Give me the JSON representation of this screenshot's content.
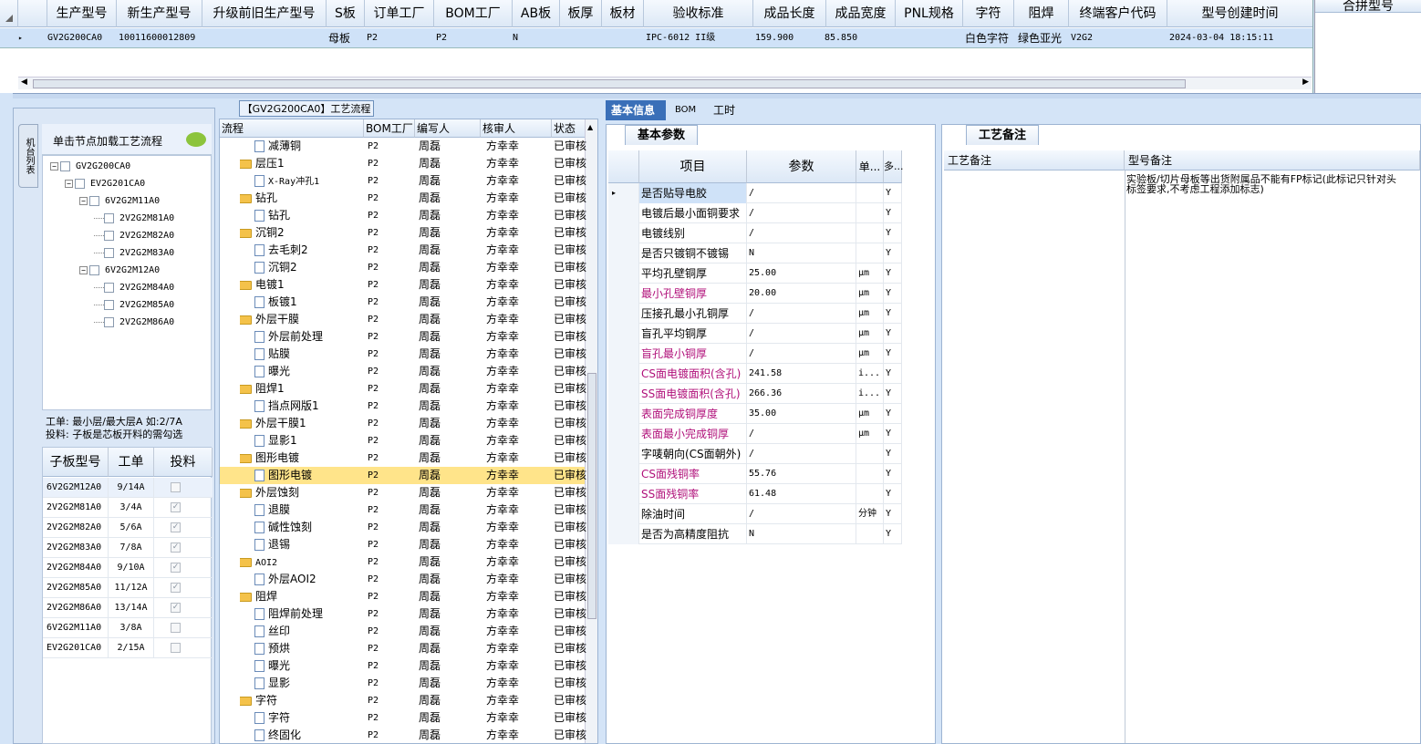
{
  "top_grid": {
    "headers": [
      "生产型号",
      "新生产型号",
      "升级前旧生产型号",
      "S板",
      "订单工厂",
      "BOM工厂",
      "AB板",
      "板厚",
      "板材",
      "验收标准",
      "成品长度",
      "成品宽度",
      "PNL规格",
      "字符",
      "阻焊",
      "终端客户代码",
      "型号创建时间"
    ],
    "row": {
      "marker": "▸",
      "model": "GV2G200CA0",
      "new_model": "10011600012809",
      "s_board": "母板",
      "order_factory": "P2",
      "bom_factory": "P2",
      "ab": "N",
      "standard": "IPC-6012 II级",
      "length": "159.900",
      "width": "85.850",
      "char": "白色字符",
      "solder": "绿色亚光",
      "customer": "V2G2",
      "created": "2024-03-04 18:15:11"
    },
    "merge_header": "合拼型号"
  },
  "left_panel": {
    "vtab": "机台列表",
    "hint": "单击节点加载工艺流程",
    "tree": [
      {
        "label": "GV2G200CA0",
        "level": 0,
        "exp": "−"
      },
      {
        "label": "EV2G201CA0",
        "level": 1,
        "exp": "−"
      },
      {
        "label": "6V2G2M11A0",
        "level": 2,
        "exp": "−"
      },
      {
        "label": "2V2G2M81A0",
        "level": 3,
        "exp": ""
      },
      {
        "label": "2V2G2M82A0",
        "level": 3,
        "exp": ""
      },
      {
        "label": "2V2G2M83A0",
        "level": 3,
        "exp": ""
      },
      {
        "label": "6V2G2M12A0",
        "level": 2,
        "exp": "−"
      },
      {
        "label": "2V2G2M84A0",
        "level": 3,
        "exp": ""
      },
      {
        "label": "2V2G2M85A0",
        "level": 3,
        "exp": ""
      },
      {
        "label": "2V2G2M86A0",
        "level": 3,
        "exp": ""
      }
    ],
    "note_line1": "工单: 最小层/最大层A 如:2/7A",
    "note_line2": "投料: 子板是芯板开料的需勾选",
    "sub_headers": [
      "子板型号",
      "工单",
      "投料"
    ],
    "sub_rows": [
      {
        "model": "6V2G2M12A0",
        "order": "9/14A",
        "checked": false
      },
      {
        "model": "2V2G2M81A0",
        "order": "3/4A",
        "checked": true
      },
      {
        "model": "2V2G2M82A0",
        "order": "5/6A",
        "checked": true
      },
      {
        "model": "2V2G2M83A0",
        "order": "7/8A",
        "checked": true
      },
      {
        "model": "2V2G2M84A0",
        "order": "9/10A",
        "checked": true
      },
      {
        "model": "2V2G2M85A0",
        "order": "11/12A",
        "checked": true
      },
      {
        "model": "2V2G2M86A0",
        "order": "13/14A",
        "checked": true
      },
      {
        "model": "6V2G2M11A0",
        "order": "3/8A",
        "checked": false
      },
      {
        "model": "EV2G201CA0",
        "order": "2/15A",
        "checked": false
      }
    ]
  },
  "flow": {
    "title": "【GV2G200CA0】工艺流程",
    "headers": [
      "流程",
      "BOM工厂",
      "编写人",
      "核审人",
      "状态"
    ],
    "rows": [
      {
        "name": "减薄铜",
        "type": "doc",
        "level": 2,
        "bom": "P2",
        "writer": "周磊",
        "auditor": "方幸幸",
        "status": "已审核"
      },
      {
        "name": "层压1",
        "type": "folder",
        "level": 1,
        "bom": "P2",
        "writer": "周磊",
        "auditor": "方幸幸",
        "status": "已审核"
      },
      {
        "name": "X-Ray冲孔1",
        "type": "doc",
        "level": 2,
        "bom": "P2",
        "writer": "周磊",
        "auditor": "方幸幸",
        "status": "已审核"
      },
      {
        "name": "钻孔",
        "type": "folder",
        "level": 1,
        "bom": "P2",
        "writer": "周磊",
        "auditor": "方幸幸",
        "status": "已审核"
      },
      {
        "name": "钻孔",
        "type": "doc",
        "level": 2,
        "bom": "P2",
        "writer": "周磊",
        "auditor": "方幸幸",
        "status": "已审核"
      },
      {
        "name": "沉铜2",
        "type": "folder",
        "level": 1,
        "bom": "P2",
        "writer": "周磊",
        "auditor": "方幸幸",
        "status": "已审核"
      },
      {
        "name": "去毛刺2",
        "type": "doc",
        "level": 2,
        "bom": "P2",
        "writer": "周磊",
        "auditor": "方幸幸",
        "status": "已审核"
      },
      {
        "name": "沉铜2",
        "type": "doc",
        "level": 2,
        "bom": "P2",
        "writer": "周磊",
        "auditor": "方幸幸",
        "status": "已审核"
      },
      {
        "name": "电镀1",
        "type": "folder",
        "level": 1,
        "bom": "P2",
        "writer": "周磊",
        "auditor": "方幸幸",
        "status": "已审核"
      },
      {
        "name": "板镀1",
        "type": "doc",
        "level": 2,
        "bom": "P2",
        "writer": "周磊",
        "auditor": "方幸幸",
        "status": "已审核"
      },
      {
        "name": "外层干膜",
        "type": "folder",
        "level": 1,
        "bom": "P2",
        "writer": "周磊",
        "auditor": "方幸幸",
        "status": "已审核"
      },
      {
        "name": "外层前处理",
        "type": "doc",
        "level": 2,
        "bom": "P2",
        "writer": "周磊",
        "auditor": "方幸幸",
        "status": "已审核"
      },
      {
        "name": "贴膜",
        "type": "doc",
        "level": 2,
        "bom": "P2",
        "writer": "周磊",
        "auditor": "方幸幸",
        "status": "已审核"
      },
      {
        "name": "曝光",
        "type": "doc",
        "level": 2,
        "bom": "P2",
        "writer": "周磊",
        "auditor": "方幸幸",
        "status": "已审核"
      },
      {
        "name": "阻焊1",
        "type": "folder",
        "level": 1,
        "bom": "P2",
        "writer": "周磊",
        "auditor": "方幸幸",
        "status": "已审核"
      },
      {
        "name": "挡点网版1",
        "type": "doc",
        "level": 2,
        "bom": "P2",
        "writer": "周磊",
        "auditor": "方幸幸",
        "status": "已审核"
      },
      {
        "name": "外层干膜1",
        "type": "folder",
        "level": 1,
        "bom": "P2",
        "writer": "周磊",
        "auditor": "方幸幸",
        "status": "已审核"
      },
      {
        "name": "显影1",
        "type": "doc",
        "level": 2,
        "bom": "P2",
        "writer": "周磊",
        "auditor": "方幸幸",
        "status": "已审核"
      },
      {
        "name": "图形电镀",
        "type": "folder",
        "level": 1,
        "bom": "P2",
        "writer": "周磊",
        "auditor": "方幸幸",
        "status": "已审核"
      },
      {
        "name": "图形电镀",
        "type": "doc",
        "level": 2,
        "bom": "P2",
        "writer": "周磊",
        "auditor": "方幸幸",
        "status": "已审核",
        "selected": true
      },
      {
        "name": "外层蚀刻",
        "type": "folder",
        "level": 1,
        "bom": "P2",
        "writer": "周磊",
        "auditor": "方幸幸",
        "status": "已审核"
      },
      {
        "name": "退膜",
        "type": "doc",
        "level": 2,
        "bom": "P2",
        "writer": "周磊",
        "auditor": "方幸幸",
        "status": "已审核"
      },
      {
        "name": "碱性蚀刻",
        "type": "doc",
        "level": 2,
        "bom": "P2",
        "writer": "周磊",
        "auditor": "方幸幸",
        "status": "已审核"
      },
      {
        "name": "退锡",
        "type": "doc",
        "level": 2,
        "bom": "P2",
        "writer": "周磊",
        "auditor": "方幸幸",
        "status": "已审核"
      },
      {
        "name": "AOI2",
        "type": "folder",
        "level": 1,
        "bom": "P2",
        "writer": "周磊",
        "auditor": "方幸幸",
        "status": "已审核"
      },
      {
        "name": "外层AOI2",
        "type": "doc",
        "level": 2,
        "bom": "P2",
        "writer": "周磊",
        "auditor": "方幸幸",
        "status": "已审核"
      },
      {
        "name": "阻焊",
        "type": "folder",
        "level": 1,
        "bom": "P2",
        "writer": "周磊",
        "auditor": "方幸幸",
        "status": "已审核"
      },
      {
        "name": "阻焊前处理",
        "type": "doc",
        "level": 2,
        "bom": "P2",
        "writer": "周磊",
        "auditor": "方幸幸",
        "status": "已审核"
      },
      {
        "name": "丝印",
        "type": "doc",
        "level": 2,
        "bom": "P2",
        "writer": "周磊",
        "auditor": "方幸幸",
        "status": "已审核"
      },
      {
        "name": "预烘",
        "type": "doc",
        "level": 2,
        "bom": "P2",
        "writer": "周磊",
        "auditor": "方幸幸",
        "status": "已审核"
      },
      {
        "name": "曝光",
        "type": "doc",
        "level": 2,
        "bom": "P2",
        "writer": "周磊",
        "auditor": "方幸幸",
        "status": "已审核"
      },
      {
        "name": "显影",
        "type": "doc",
        "level": 2,
        "bom": "P2",
        "writer": "周磊",
        "auditor": "方幸幸",
        "status": "已审核"
      },
      {
        "name": "字符",
        "type": "folder",
        "level": 1,
        "bom": "P2",
        "writer": "周磊",
        "auditor": "方幸幸",
        "status": "已审核"
      },
      {
        "name": "字符",
        "type": "doc",
        "level": 2,
        "bom": "P2",
        "writer": "周磊",
        "auditor": "方幸幸",
        "status": "已审核"
      },
      {
        "name": "终固化",
        "type": "doc",
        "level": 2,
        "bom": "P2",
        "writer": "周磊",
        "auditor": "方幸幸",
        "status": "已审核"
      }
    ]
  },
  "detail_tabs": [
    "基本信息",
    "BOM",
    "工时"
  ],
  "basic": {
    "group_title": "基本参数",
    "headers": [
      "项目",
      "参数",
      "单...",
      "多..."
    ],
    "rows": [
      {
        "item": "是否贴导电胶",
        "value": "/",
        "unit": "",
        "flag": "Y",
        "pink": false,
        "marker": "▸"
      },
      {
        "item": "电镀后最小面铜要求",
        "value": "/",
        "unit": "",
        "flag": "Y",
        "pink": false
      },
      {
        "item": "电镀线别",
        "value": "/",
        "unit": "",
        "flag": "Y",
        "pink": false
      },
      {
        "item": "是否只镀铜不镀锡",
        "value": "N",
        "unit": "",
        "flag": "Y",
        "pink": false
      },
      {
        "item": "平均孔壁铜厚",
        "value": "25.00",
        "unit": "μm",
        "flag": "Y",
        "pink": false
      },
      {
        "item": "最小孔壁铜厚",
        "value": "20.00",
        "unit": "μm",
        "flag": "Y",
        "pink": true
      },
      {
        "item": "压接孔最小孔铜厚",
        "value": "/",
        "unit": "μm",
        "flag": "Y",
        "pink": false
      },
      {
        "item": "盲孔平均铜厚",
        "value": "/",
        "unit": "μm",
        "flag": "Y",
        "pink": false
      },
      {
        "item": "盲孔最小铜厚",
        "value": "/",
        "unit": "μm",
        "flag": "Y",
        "pink": true
      },
      {
        "item": "CS面电镀面积(含孔)",
        "value": "241.58",
        "unit": "i...",
        "flag": "Y",
        "pink": true
      },
      {
        "item": "SS面电镀面积(含孔)",
        "value": "266.36",
        "unit": "i...",
        "flag": "Y",
        "pink": true
      },
      {
        "item": "表面完成铜厚度",
        "value": "35.00",
        "unit": "μm",
        "flag": "Y",
        "pink": true
      },
      {
        "item": "表面最小完成铜厚",
        "value": "/",
        "unit": "μm",
        "flag": "Y",
        "pink": true
      },
      {
        "item": "字唛朝向(CS面朝外)",
        "value": "/",
        "unit": "",
        "flag": "Y",
        "pink": false
      },
      {
        "item": "CS面残铜率",
        "value": "55.76",
        "unit": "",
        "flag": "Y",
        "pink": true
      },
      {
        "item": "SS面残铜率",
        "value": "61.48",
        "unit": "",
        "flag": "Y",
        "pink": true
      },
      {
        "item": "除油时间",
        "value": "/",
        "unit": "分钟",
        "flag": "Y",
        "pink": false
      },
      {
        "item": "是否为高精度阻抗",
        "value": "N",
        "unit": "",
        "flag": "Y",
        "pink": false
      }
    ]
  },
  "remarks": {
    "group_title": "工艺备注",
    "headers": [
      "工艺备注",
      "型号备注"
    ],
    "model_note_line1": "实验板/切片母板等出货附属品不能有FP标记(此标记只针对头",
    "model_note_line2": "标签要求,不考虑工程添加标志)"
  },
  "colors": {
    "selected_row": "#cfe2f8",
    "tab_active": "#3a6fb8",
    "flow_highlight": "#ffe48a",
    "pink_text": "#b0107a"
  }
}
